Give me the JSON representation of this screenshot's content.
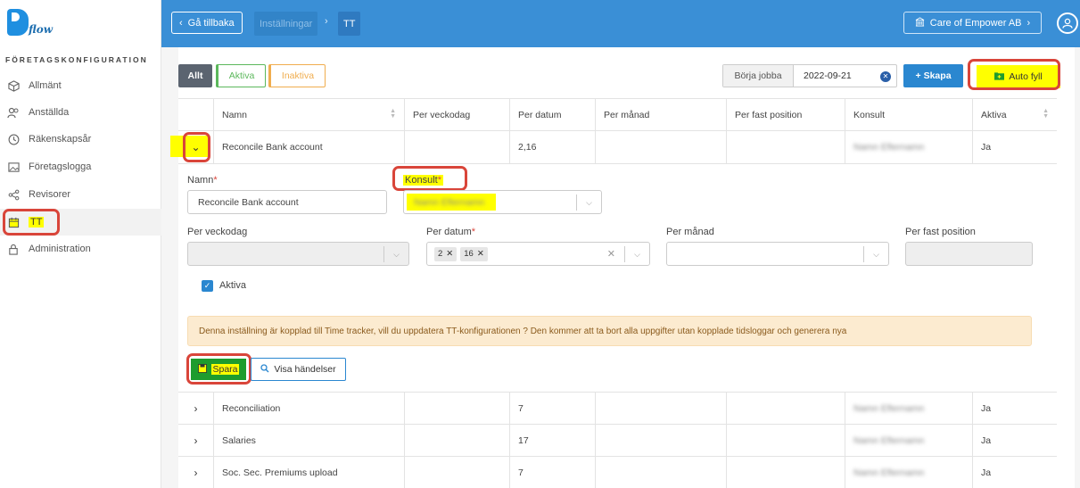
{
  "sidebar": {
    "logo_text": "flow",
    "section": "FÖRETAGSKONFIGURATION",
    "items": [
      {
        "label": "Allmänt",
        "icon": "cube-icon"
      },
      {
        "label": "Anställda",
        "icon": "users-icon"
      },
      {
        "label": "Räkenskapsår",
        "icon": "clock-icon"
      },
      {
        "label": "Företagslogga",
        "icon": "image-icon"
      },
      {
        "label": "Revisorer",
        "icon": "share-icon"
      },
      {
        "label": "TT",
        "icon": "calendar-icon",
        "active": true
      },
      {
        "label": "Administration",
        "icon": "lock-icon"
      }
    ]
  },
  "topbar": {
    "back_label": "Gå tillbaka",
    "breadcrumb": [
      "Inställningar",
      "TT"
    ],
    "company": "Care of Empower AB"
  },
  "filters": {
    "all": "Allt",
    "active": "Aktiva",
    "inactive": "Inaktiva"
  },
  "start_job": {
    "label": "Börja jobba",
    "value": "2022-09-21"
  },
  "buttons": {
    "create": "Skapa",
    "autofill": "Auto fyll",
    "save": "Spara",
    "events": "Visa händelser"
  },
  "table": {
    "columns": [
      "Namn",
      "Per veckodag",
      "Per datum",
      "Per månad",
      "Per fast position",
      "Konsult",
      "Aktiva"
    ],
    "expanded_row": {
      "name": "Reconcile Bank account",
      "per_datum": "2,16",
      "konsult": "Namn Efternamn",
      "aktiva": "Ja"
    },
    "rows": [
      {
        "name": "Reconciliation",
        "per_datum": "7",
        "konsult": "Namn Efternamn",
        "aktiva": "Ja"
      },
      {
        "name": "Salaries",
        "per_datum": "17",
        "konsult": "Namn Efternamn",
        "aktiva": "Ja"
      },
      {
        "name": "Soc. Sec. Premiums upload",
        "per_datum": "7",
        "konsult": "Namn Efternamn",
        "aktiva": "Ja"
      }
    ]
  },
  "form": {
    "name_label": "Namn",
    "name_value": "Reconcile Bank account",
    "konsult_label": "Konsult",
    "konsult_value": "Namn Efternamn",
    "weekday_label": "Per veckodag",
    "date_label": "Per datum",
    "date_tags": [
      "2",
      "16"
    ],
    "month_label": "Per månad",
    "fixed_label": "Per fast position",
    "active_label": "Aktiva",
    "alert": "Denna inställning är kopplad till Time tracker, vill du uppdatera TT-konfigurationen ? Den kommer att ta bort alla uppgifter utan kopplade tidsloggar och generera nya"
  },
  "colors": {
    "primary": "#3a8fd6",
    "highlight": "#ffff00",
    "annotation": "#d9453a",
    "save": "#1e9c2e"
  }
}
